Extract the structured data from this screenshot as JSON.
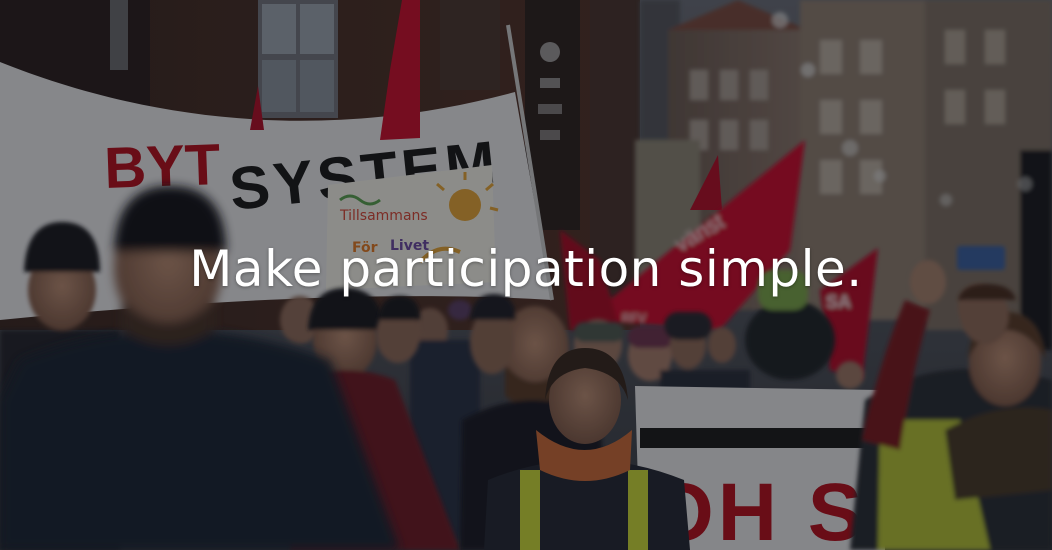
{
  "hero": {
    "headline": "Make participation simple."
  },
  "photo": {
    "banner_main_text_red": "BYT",
    "banner_main_text_black": "SYSTEM",
    "banner_poster_line1": "Tillsammans",
    "banner_poster_line2": "För",
    "banner_poster_line3": "Livet",
    "banner_lower_text": "OH SH",
    "flag_text_1": "vänst",
    "flag_text_2": "SA",
    "flag_text_3": "RFV"
  },
  "colors": {
    "overlay": "#0a0c12",
    "headline": "#ffffff",
    "flag_red": "#c8102e",
    "banner_white": "#e9e9ea",
    "banner_black": "#1b1b1b",
    "banner_red": "#b3121f",
    "vest_yellow": "#c9d63a"
  }
}
